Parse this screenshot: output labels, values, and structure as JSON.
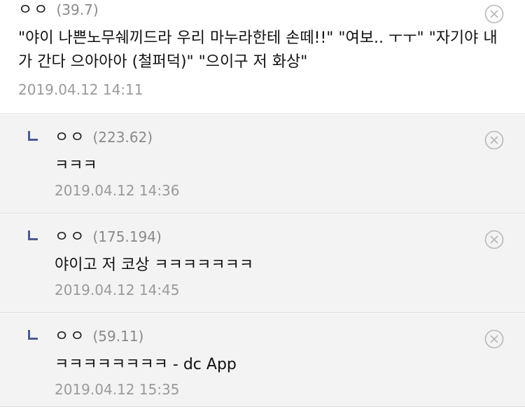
{
  "main_comment": {
    "nick": "ㅇㅇ",
    "ip": "(39.7)",
    "body": "\"야이 나쁜노무쉐끼드라 우리 마누라한테 손떼!!\" \"여보.. ㅜㅜ\" \"자기야 내가 간다 으아아아 (철퍼덕)\" \"으이구 저 화상\"",
    "date": "2019.04.12 14:11"
  },
  "replies": [
    {
      "nick": "ㅇㅇ",
      "ip": "(223.62)",
      "body": "ㅋㅋㅋ",
      "date": "2019.04.12 14:36"
    },
    {
      "nick": "ㅇㅇ",
      "ip": "(175.194)",
      "body": "야이고 저 코상 ㅋㅋㅋㅋㅋㅋㅋ",
      "date": "2019.04.12 14:45"
    },
    {
      "nick": "ㅇㅇ",
      "ip": "(59.11)",
      "body": "ㅋㅋㅋㅋㅋㅋㅋㅋ - dc App",
      "date": "2019.04.12 15:35"
    }
  ],
  "icons": {
    "delete": "close-circle-icon",
    "reply": "reply-arrow-icon"
  },
  "colors": {
    "reply_marker": "#4b5b96",
    "reply_background": "#f3f3f3",
    "meta_text": "#9a9a9a"
  }
}
